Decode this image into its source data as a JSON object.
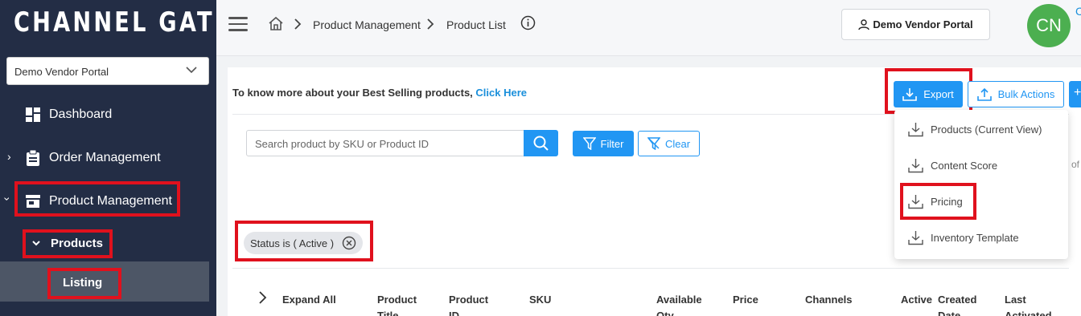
{
  "app": {
    "logo_text": "CHANNEL GATE"
  },
  "sidebar": {
    "portal_select": "Demo Vendor Portal",
    "items": [
      {
        "label": "Dashboard",
        "icon": "dashboard-icon"
      },
      {
        "label": "Order Management",
        "icon": "clipboard-icon"
      },
      {
        "label": "Product Management",
        "icon": "store-icon"
      },
      {
        "label": "Products",
        "icon": "chevron-down-icon"
      },
      {
        "label": "Listing"
      }
    ]
  },
  "topbar": {
    "breadcrumb": [
      "Product Management",
      "Product List"
    ],
    "vendor_button": "Demo Vendor Portal",
    "avatar_initials": "CN",
    "edge_letter": "C"
  },
  "main": {
    "hint_text": "To know more about your Best Selling products, ",
    "hint_link": "Click Here",
    "export_label": "Export",
    "bulk_label": "Bulk Actions",
    "search_placeholder": "Search product by SKU or Product ID",
    "filter_label": "Filter",
    "clear_label": "Clear",
    "chip_label": "Status is ( Active )",
    "right_edge_text": "of",
    "table_headers": [
      {
        "line1": "Expand All",
        "line2": ""
      },
      {
        "line1": "Product",
        "line2": "Title"
      },
      {
        "line1": "Product",
        "line2": "ID"
      },
      {
        "line1": "SKU",
        "line2": ""
      },
      {
        "line1": "Available",
        "line2": "Qty"
      },
      {
        "line1": "Price",
        "line2": ""
      },
      {
        "line1": "Channels",
        "line2": ""
      },
      {
        "line1": "Active",
        "line2": ""
      },
      {
        "line1": "Created",
        "line2": "Date"
      },
      {
        "line1": "Last",
        "line2": "Activated"
      }
    ]
  },
  "export_menu": {
    "items": [
      "Products (Current View)",
      "Content Score",
      "Pricing",
      "Inventory Template"
    ]
  },
  "colors": {
    "sidebar_bg": "#232d45",
    "accent": "#2196f3",
    "highlight_red": "#e0111d",
    "avatar": "#4caf50"
  }
}
